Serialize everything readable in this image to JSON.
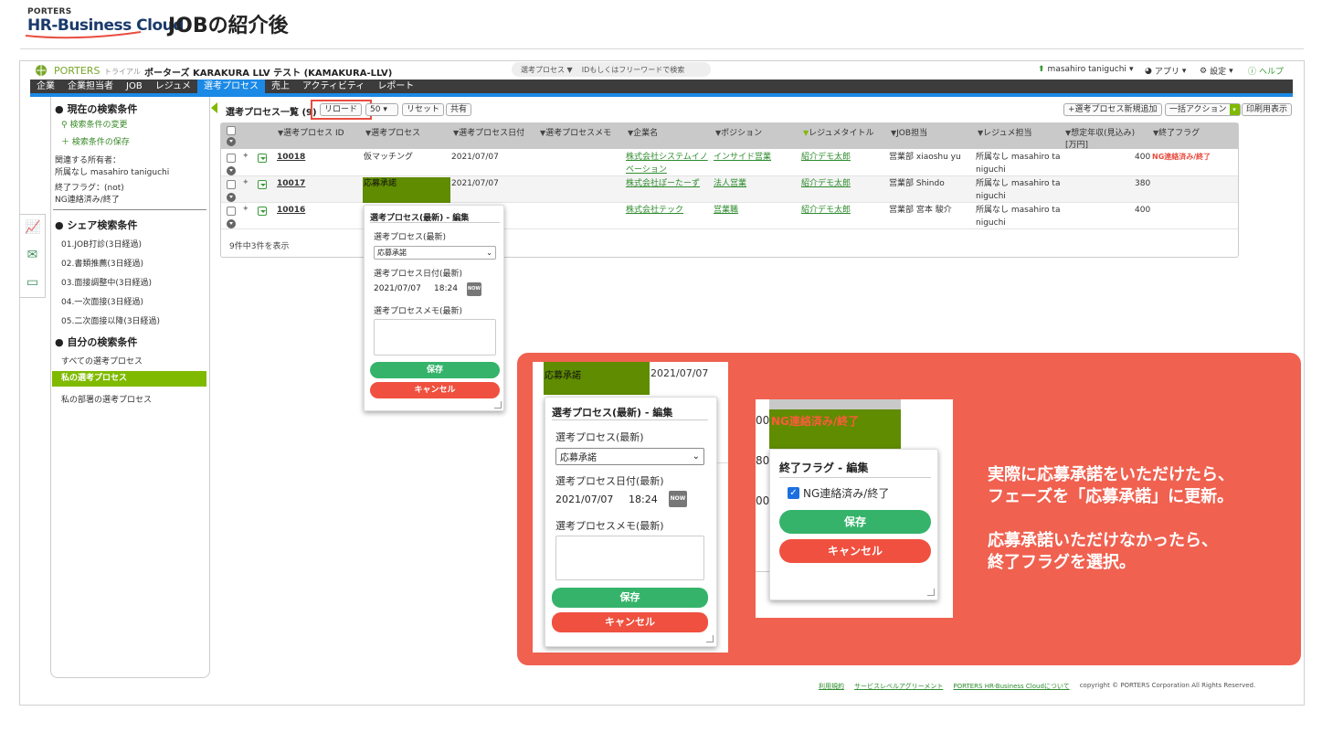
{
  "slide": {
    "logo_top": "PORTERS",
    "logo_main": "HR-Business Cloud",
    "title": "JOBの紹介後"
  },
  "topbar": {
    "brand": "PORTERS",
    "trial": "トライアル",
    "tenant": "ポーターズ KARAKURA LLV テスト (KAMAKURA-LLV)",
    "search_scope": "選考プロセス",
    "search_placeholder": "IDもしくはフリーワードで検索",
    "user": "masahiro taniguchi",
    "apps": "アプリ",
    "settings": "設定",
    "help": "ヘルプ"
  },
  "nav": {
    "items": [
      "企業",
      "企業担当者",
      "JOB",
      "レジュメ",
      "選考プロセス",
      "売上",
      "アクティビティ",
      "レポート"
    ],
    "active_index": 4
  },
  "sidebar": {
    "current_heading": "現在の検索条件",
    "change_link": "検索条件の変更",
    "save_link": "検索条件の保存",
    "cond1_label": "関連する所有者：",
    "cond1_value": "所属なし masahiro taniguchi",
    "cond2_label": "終了フラグ：(not)",
    "cond2_value": "NG連絡済み/終了",
    "shared_heading": "シェア検索条件",
    "shared_items": [
      "01.JOB打診(3日経過)",
      "02.書類推薦(3日経過)",
      "03.面接調整中(3日経過)",
      "04.一次面接(3日経過)",
      "05.二次面接以降(3日経過)"
    ],
    "own_heading": "自分の検索条件",
    "own_items": [
      "すべての選考プロセス",
      "私の選考プロセス",
      "私の部署の選考プロセス"
    ]
  },
  "list": {
    "title": "選考プロセス一覧 (9)",
    "reload": "リロード",
    "per_page": "50",
    "reset": "リセット",
    "share": "共有",
    "add_new": "+選考プロセス新規追加",
    "bulk_action": "一括アクション",
    "print": "印刷用表示",
    "count_text": "9件中3件を表示"
  },
  "table": {
    "headers": [
      "選考プロセス ID",
      "選考プロセス",
      "選考プロセス日付",
      "選考プロセスメモ",
      "企業名",
      "ポジション",
      "レジュメタイトル",
      "JOB担当",
      "レジュメ担当",
      "想定年収(見込み)",
      "終了フラグ"
    ],
    "header_unit": "[万円]",
    "rows": [
      {
        "id": "10018",
        "process": "仮マッチング",
        "date": "2021/07/07",
        "company": "株式会社システムイノベーション",
        "position": "インサイド営業",
        "resume": "紹介デモ太郎",
        "job_owner": "営業部 xiaoshu yu",
        "resume_owner": "所属なし masahiro taniguchi",
        "salary": "400",
        "flag": "NG連絡済み/終了"
      },
      {
        "id": "10017",
        "process": "応募承諾",
        "date": "2021/07/07",
        "company": "株式会社ぽーたーず",
        "position": "法人営業",
        "resume": "紹介デモ太郎",
        "job_owner": "営業部 Shindo",
        "resume_owner": "所属なし masahiro taniguchi",
        "salary": "380",
        "flag": ""
      },
      {
        "id": "10016",
        "process": "",
        "date": "",
        "company": "株式会社テック",
        "position": "営業職",
        "resume": "紹介デモ太郎",
        "job_owner": "営業部 宮本 駿介",
        "resume_owner": "所属なし masahiro taniguchi",
        "salary": "400",
        "flag": ""
      }
    ]
  },
  "edit_popup": {
    "title": "選考プロセス(最新) - 編集",
    "process_label": "選考プロセス(最新)",
    "process_value": "応募承諾",
    "date_label": "選考プロセス日付(最新)",
    "date_value": "2021/07/07",
    "time_value": "18:24",
    "now": "NOW",
    "memo_label": "選考プロセスメモ(最新)",
    "save": "保存",
    "cancel": "キャンセル"
  },
  "callout": {
    "zoom1_cell_process": "応募承諾",
    "zoom1_cell_date": "2021/07/07",
    "zoom2_flag_cell": "NG連絡済み/終了",
    "zoom2_prefix": [
      "00",
      "80",
      "00"
    ],
    "flag_popup_title": "終了フラグ - 編集",
    "flag_option": "NG連絡済み/終了",
    "text": "実際に応募承諾をいただけたら、\nフェーズを「応募承諾」に更新。\n\n応募承諾いただけなかったら、\n終了フラグを選択。"
  },
  "footer": {
    "links": [
      "利用規約",
      "サービスレベルアグリーメント",
      "PORTERS HR-Business Cloudについて"
    ],
    "copyright": "copyright © PORTERS Corporation All Rights Reserved."
  },
  "colors": {
    "accent_green": "#7fba00",
    "nav_blue": "#1b89e6",
    "callout_red": "#f06150",
    "save_green": "#35b36b",
    "cancel_red": "#f0503f"
  }
}
